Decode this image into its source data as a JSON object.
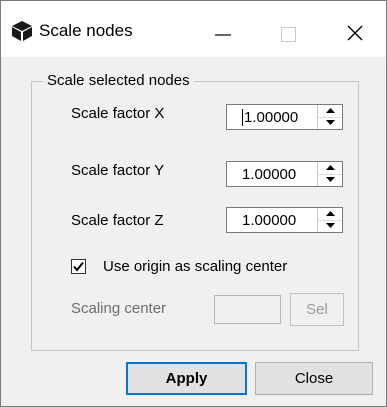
{
  "window": {
    "title": "Scale nodes",
    "icon": "cube-icon"
  },
  "group": {
    "label": "Scale selected nodes"
  },
  "fields": {
    "scale_x": {
      "label": "Scale factor X",
      "value": "1.00000"
    },
    "scale_y": {
      "label": "Scale factor Y",
      "value": "1.00000"
    },
    "scale_z": {
      "label": "Scale factor Z",
      "value": "1.00000"
    }
  },
  "use_origin": {
    "label": "Use origin as scaling center",
    "checked": true
  },
  "scaling_center": {
    "label": "Scaling center",
    "value": "",
    "sel_label": "Sel"
  },
  "buttons": {
    "apply": "Apply",
    "close": "Close"
  },
  "titlebar_icons": [
    "minimize-icon",
    "maximize-icon",
    "close-icon"
  ]
}
